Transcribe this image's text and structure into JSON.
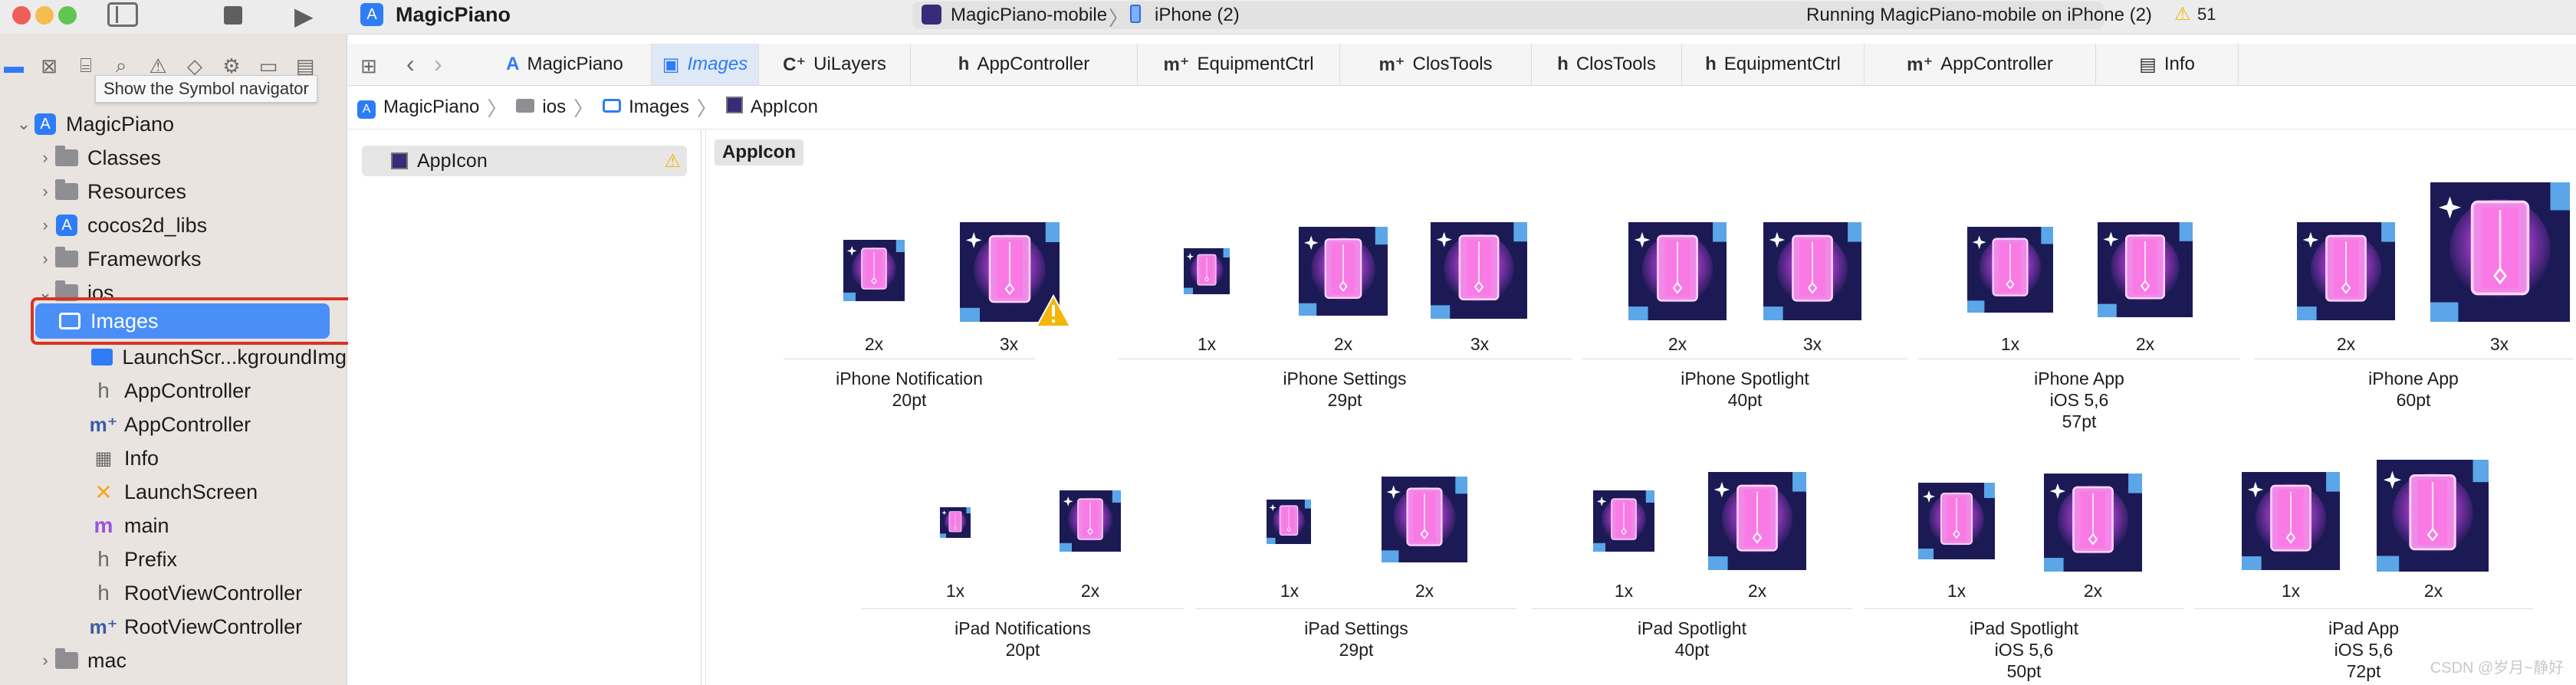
{
  "window": {
    "app_name": "MagicPiano",
    "scheme": {
      "target": "MagicPiano-mobile",
      "separator": "〉",
      "device": "iPhone (2)"
    },
    "status": "Running MagicPiano-mobile on iPhone (2)",
    "warning_count": "51"
  },
  "navigator": {
    "tooltip": "Show the Symbol navigator",
    "icons": [
      "folder-icon",
      "x-square-icon",
      "hierarchy-icon",
      "search-icon",
      "warning-icon",
      "diamond-icon",
      "debug-icon",
      "breakpoint-icon",
      "report-icon"
    ],
    "tree": [
      {
        "label": "MagicPiano",
        "icon": "app-icon",
        "level": 0,
        "chevron": "⌄"
      },
      {
        "label": "Classes",
        "icon": "folder-icon",
        "level": 1,
        "chevron": "›"
      },
      {
        "label": "Resources",
        "icon": "folder-icon",
        "level": 1,
        "chevron": "›"
      },
      {
        "label": "cocos2d_libs",
        "icon": "app-icon",
        "level": 1,
        "chevron": "›"
      },
      {
        "label": "Frameworks",
        "icon": "folder-icon",
        "level": 1,
        "chevron": "›"
      },
      {
        "label": "ios",
        "icon": "folder-icon",
        "level": 1,
        "chevron": "⌄"
      },
      {
        "label": "Images",
        "icon": "asset-catalog-icon",
        "level": 2,
        "chevron": "",
        "selected": true
      },
      {
        "label": "LaunchScr...kgroundImg",
        "icon": "image-icon",
        "level": 2,
        "chevron": ""
      },
      {
        "label": "AppController",
        "icon": "header-icon",
        "level": 2,
        "chevron": ""
      },
      {
        "label": "AppController",
        "icon": "objc-icon",
        "level": 2,
        "chevron": ""
      },
      {
        "label": "Info",
        "icon": "plist-icon",
        "level": 2,
        "chevron": ""
      },
      {
        "label": "LaunchScreen",
        "icon": "storyboard-icon",
        "level": 2,
        "chevron": ""
      },
      {
        "label": "main",
        "icon": "m-file-icon",
        "level": 2,
        "chevron": ""
      },
      {
        "label": "Prefix",
        "icon": "header-icon",
        "level": 2,
        "chevron": ""
      },
      {
        "label": "RootViewController",
        "icon": "header-icon",
        "level": 2,
        "chevron": ""
      },
      {
        "label": "RootViewController",
        "icon": "objc-icon",
        "level": 2,
        "chevron": ""
      },
      {
        "label": "mac",
        "icon": "folder-icon",
        "level": 1,
        "chevron": "›"
      }
    ]
  },
  "tabs": [
    {
      "label": "MagicPiano",
      "icon": "app-icon",
      "glyph": "A"
    },
    {
      "label": "Images",
      "icon": "asset-catalog-icon",
      "glyph": "▣",
      "active": true
    },
    {
      "label": "UiLayers",
      "icon": "class-icon",
      "glyph": "C⁺"
    },
    {
      "label": "AppController",
      "icon": "header-icon",
      "glyph": "h"
    },
    {
      "label": "EquipmentCtrl",
      "icon": "objc-icon",
      "glyph": "m⁺"
    },
    {
      "label": "ClosTools",
      "icon": "objc-icon",
      "glyph": "m⁺"
    },
    {
      "label": "ClosTools",
      "icon": "header-icon",
      "glyph": "h"
    },
    {
      "label": "EquipmentCtrl",
      "icon": "header-icon",
      "glyph": "h"
    },
    {
      "label": "AppController",
      "icon": "objc-icon",
      "glyph": "m⁺"
    },
    {
      "label": "Info",
      "icon": "plist-icon",
      "glyph": "▤"
    }
  ],
  "breadcrumb": [
    {
      "label": "MagicPiano",
      "icon": "app-icon"
    },
    {
      "label": "ios",
      "icon": "folder-icon"
    },
    {
      "label": "Images",
      "icon": "asset-catalog-icon"
    },
    {
      "label": "AppIcon",
      "icon": "appicon-icon"
    }
  ],
  "asset_list": [
    {
      "label": "AppIcon",
      "warning": true
    }
  ],
  "icon_set": {
    "name": "AppIcon",
    "rows": [
      [
        {
          "title": "iPhone Notification",
          "size": "20pt",
          "slots": [
            {
              "scale": "2x"
            },
            {
              "scale": "3x",
              "warning": true
            }
          ]
        },
        {
          "title": "iPhone Settings",
          "size": "29pt",
          "slots": [
            {
              "scale": "1x"
            },
            {
              "scale": "2x"
            },
            {
              "scale": "3x"
            }
          ]
        },
        {
          "title": "iPhone Spotlight",
          "size": "40pt",
          "slots": [
            {
              "scale": "2x"
            },
            {
              "scale": "3x"
            }
          ]
        },
        {
          "title": "iPhone App",
          "sub": "iOS 5,6",
          "size": "57pt",
          "slots": [
            {
              "scale": "1x"
            },
            {
              "scale": "2x"
            }
          ]
        },
        {
          "title": "iPhone App",
          "size": "60pt",
          "slots": [
            {
              "scale": "2x"
            },
            {
              "scale": "3x"
            }
          ]
        }
      ],
      [
        {
          "title": "iPad Notifications",
          "size": "20pt",
          "slots": [
            {
              "scale": "1x"
            },
            {
              "scale": "2x"
            }
          ]
        },
        {
          "title": "iPad Settings",
          "size": "29pt",
          "slots": [
            {
              "scale": "1x"
            },
            {
              "scale": "2x"
            }
          ]
        },
        {
          "title": "iPad Spotlight",
          "size": "40pt",
          "slots": [
            {
              "scale": "1x"
            },
            {
              "scale": "2x"
            }
          ]
        },
        {
          "title": "iPad Spotlight",
          "sub": "iOS 5,6",
          "size": "50pt",
          "slots": [
            {
              "scale": "1x"
            },
            {
              "scale": "2x"
            }
          ]
        },
        {
          "title": "iPad App",
          "sub": "iOS 5,6",
          "size": "72pt",
          "slots": [
            {
              "scale": "1x"
            },
            {
              "scale": "2x"
            }
          ]
        }
      ]
    ]
  },
  "watermark": "CSDN @岁月~静好",
  "colors": {
    "accent": "#2e7cf6",
    "selection": "#4a8ff7",
    "highlight_box": "#d93327",
    "warning": "#f5b50a",
    "icon_bg": "#1c1a55",
    "icon_glow": "#e85bd9"
  }
}
